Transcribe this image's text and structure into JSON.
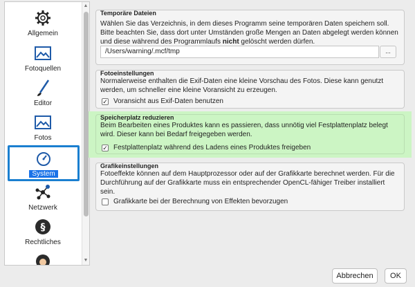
{
  "sidebar": {
    "items": [
      {
        "label": "Allgemein",
        "icon": "gear-icon"
      },
      {
        "label": "Fotoquellen",
        "icon": "photo-sources-icon"
      },
      {
        "label": "Editor",
        "icon": "brush-icon"
      },
      {
        "label": "Fotos",
        "icon": "photo-icon"
      },
      {
        "label": "System",
        "icon": "gauge-icon",
        "selected": true
      },
      {
        "label": "Netzwerk",
        "icon": "network-icon"
      },
      {
        "label": "Rechtliches",
        "icon": "paragraph-icon"
      },
      {
        "label": "",
        "icon": "support-icon"
      }
    ]
  },
  "groups": {
    "temp": {
      "title": "Temporäre Dateien",
      "text_pre": "Wählen Sie das Verzeichnis, in dem dieses Programm seine temporären Daten speichern soll. Bitte beachten Sie, dass dort unter Umständen große Mengen an Daten abgelegt werden können und diese während des Programmlaufs ",
      "text_bold": "nicht",
      "text_post": " gelöscht werden dürfen.",
      "path": "/Users/warning/.mcf/tmp",
      "browse_label": "..."
    },
    "foto": {
      "title": "Fotoeinstellungen",
      "text": "Normalerweise enthalten die Exif-Daten eine kleine Vorschau des Fotos. Diese kann genutzt werden, um schneller eine kleine Voransicht zu erzeugen.",
      "checkbox_label": "Voransicht aus Exif-Daten benutzen",
      "checked": true
    },
    "speicher": {
      "title": "Speicherplatz reduzieren",
      "text": "Beim Bearbeiten eines Produktes kann es passieren, dass unnötig viel Festplattenplatz belegt wird. Dieser kann bei Bedarf freigegeben werden.",
      "checkbox_label": "Festplattenplatz während des Ladens eines Produktes freigeben",
      "checked": true,
      "highlight_color": "#ccf5c4"
    },
    "grafik": {
      "title": "Grafikeinstellungen",
      "text": "Fotoeffekte können auf dem Hauptprozessor oder auf der Grafikkarte berechnet werden. Für die Durchführung auf der Grafikkarte muss ein entsprechender OpenCL-fähiger Treiber installiert sein.",
      "checkbox_label": "Grafikkarte bei der Berechnung von Effekten bevorzugen",
      "checked": false
    }
  },
  "buttons": {
    "cancel": "Abbrechen",
    "ok": "OK"
  },
  "checkmark": "✓",
  "colors": {
    "selection": "#1a73e8",
    "selection_border": "#1a7fd0"
  }
}
